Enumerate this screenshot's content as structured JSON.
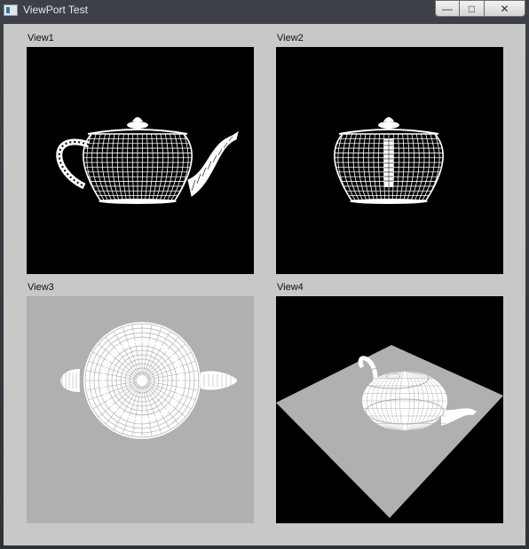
{
  "window": {
    "title": "ViewPort Test",
    "controls": {
      "minimize": "—",
      "maximize": "□",
      "close": "✕"
    }
  },
  "viewports": [
    {
      "label": "View1",
      "background": "#000000",
      "view": "side"
    },
    {
      "label": "View2",
      "background": "#000000",
      "view": "front"
    },
    {
      "label": "View3",
      "background": "#b0b0b0",
      "view": "top"
    },
    {
      "label": "View4",
      "background": "#000000",
      "view": "perspective",
      "floor_color": "#b0b0b0"
    }
  ],
  "colors": {
    "wireframe": "#ffffff",
    "client_bg": "#c8c8c8"
  },
  "icons": {
    "app": "app-window-icon",
    "minimize": "minimize-icon",
    "maximize": "maximize-icon",
    "close": "close-icon"
  }
}
